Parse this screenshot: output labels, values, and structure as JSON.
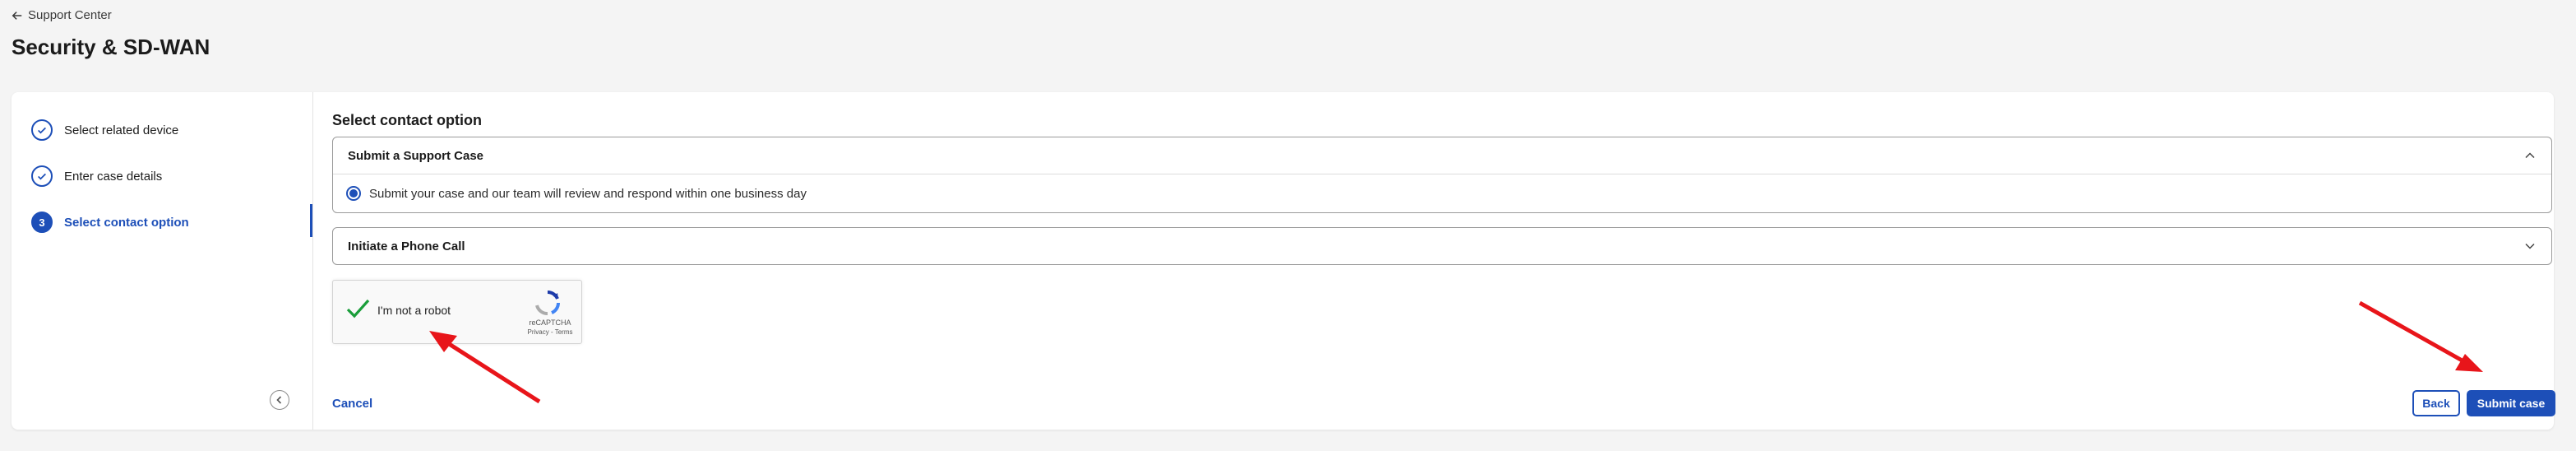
{
  "breadcrumb": {
    "label": "Support Center"
  },
  "page": {
    "title": "Security & SD-WAN"
  },
  "steps": [
    {
      "label": "Select related device",
      "state": "done"
    },
    {
      "label": "Enter case details",
      "state": "done"
    },
    {
      "label": "Select contact option",
      "state": "active",
      "number": "3"
    }
  ],
  "main": {
    "section_title": "Select contact option",
    "options": [
      {
        "title": "Submit a Support Case",
        "expanded": true,
        "description": "Submit your case and our team will review and respond within one business day"
      },
      {
        "title": "Initiate a Phone Call",
        "expanded": false
      }
    ]
  },
  "captcha": {
    "label": "I'm not a robot",
    "brand": "reCAPTCHA",
    "terms": "Privacy - Terms",
    "checked": true
  },
  "actions": {
    "cancel_label": "Cancel",
    "back_label": "Back",
    "submit_label": "Submit case"
  },
  "colors": {
    "accent": "#1d4fb8",
    "annotation_arrow": "#e8151a",
    "captcha_check": "#1a9e3a"
  }
}
